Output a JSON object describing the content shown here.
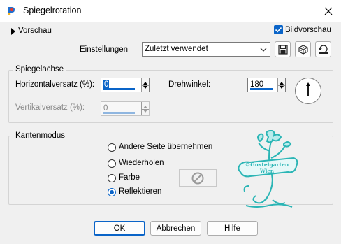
{
  "window": {
    "title": "Spiegelrotation"
  },
  "preview": {
    "label": "Vorschau",
    "image_preview_label": "Bildvorschau",
    "image_preview_checked": true
  },
  "settings": {
    "label": "Einstellungen",
    "selected": "Zuletzt verwendet"
  },
  "mirror_axis": {
    "group_label": "Spiegelachse",
    "horizontal_offset_label": "Horizontalversatz (%):",
    "horizontal_offset_value": "0",
    "vertical_offset_label": "Vertikalversatz (%):",
    "vertical_offset_value": "0",
    "rotation_label": "Drehwinkel:",
    "rotation_value": "180"
  },
  "edge_mode": {
    "group_label": "Kantenmodus",
    "options": [
      {
        "label": "Andere Seite übernehmen",
        "selected": false
      },
      {
        "label": "Wiederholen",
        "selected": false
      },
      {
        "label": "Farbe",
        "selected": false
      },
      {
        "label": "Reflektieren",
        "selected": true
      }
    ]
  },
  "watermark": {
    "text_line1": "©Gustelgarten",
    "text_line2": "Wien",
    "color": "#2ab5b5"
  },
  "buttons": {
    "ok": "OK",
    "cancel": "Abbrechen",
    "help": "Hilfe"
  },
  "colors": {
    "accent": "#0a64c8",
    "background": "#f0f0f0"
  }
}
